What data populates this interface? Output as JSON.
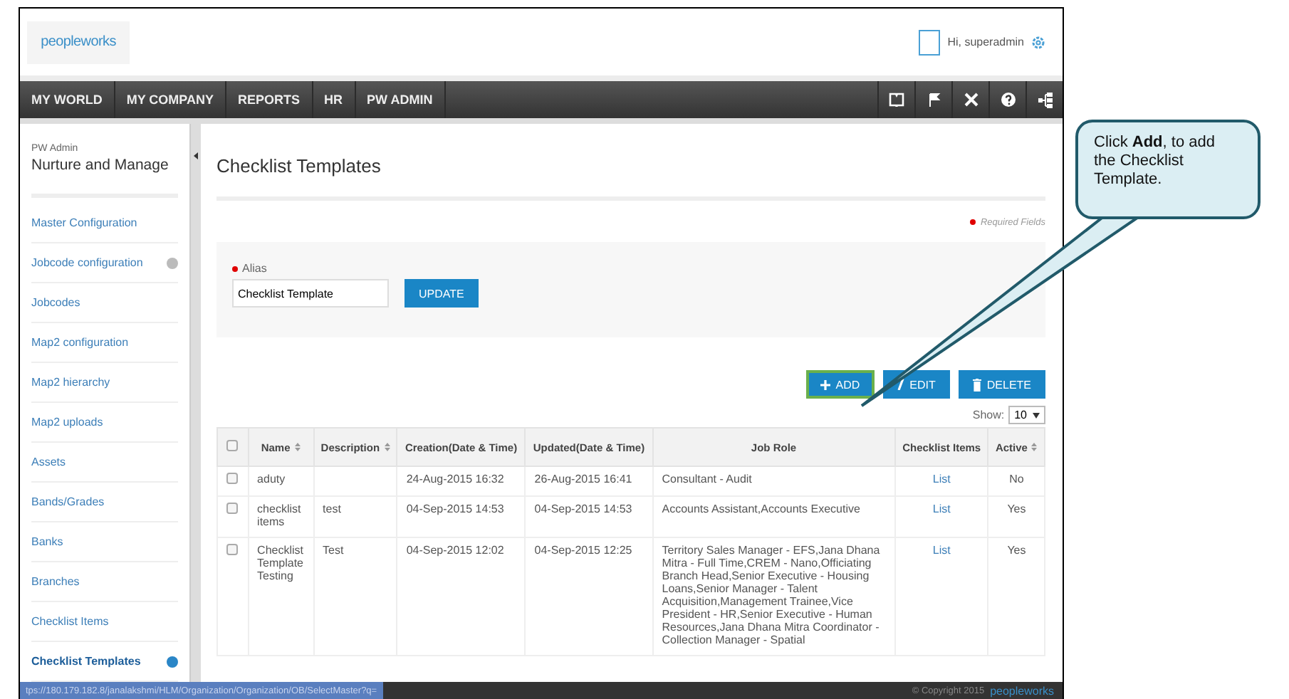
{
  "header": {
    "logo": "peopleworks",
    "greeting": "Hi, superadmin"
  },
  "nav": {
    "items": [
      {
        "label": "MY WORLD"
      },
      {
        "label": "MY COMPANY"
      },
      {
        "label": "REPORTS"
      },
      {
        "label": "HR"
      },
      {
        "label": "PW ADMIN"
      }
    ]
  },
  "sidebar": {
    "section": "PW Admin",
    "title": "Nurture and Manage",
    "items": [
      {
        "label": "Master Configuration",
        "selected": false,
        "toggle": false
      },
      {
        "label": "Jobcode configuration",
        "selected": false,
        "toggle": true
      },
      {
        "label": "Jobcodes",
        "selected": false,
        "toggle": false
      },
      {
        "label": "Map2 configuration",
        "selected": false,
        "toggle": false
      },
      {
        "label": "Map2 hierarchy",
        "selected": false,
        "toggle": false
      },
      {
        "label": "Map2 uploads",
        "selected": false,
        "toggle": false
      },
      {
        "label": "Assets",
        "selected": false,
        "toggle": false
      },
      {
        "label": "Bands/Grades",
        "selected": false,
        "toggle": false
      },
      {
        "label": "Banks",
        "selected": false,
        "toggle": false
      },
      {
        "label": "Branches",
        "selected": false,
        "toggle": false
      },
      {
        "label": "Checklist Items",
        "selected": false,
        "toggle": false
      },
      {
        "label": "Checklist Templates",
        "selected": true,
        "toggle": true
      }
    ]
  },
  "page": {
    "title": "Checklist Templates",
    "required_note": "Required Fields",
    "alias": {
      "label": "Alias",
      "value": "Checklist Template",
      "button": "UPDATE"
    },
    "actions": [
      {
        "kind": "add",
        "label": "ADD",
        "highlighted": true
      },
      {
        "kind": "edit",
        "label": "EDIT",
        "highlighted": false
      },
      {
        "kind": "delete",
        "label": "DELETE",
        "highlighted": false
      }
    ],
    "show": {
      "label": "Show:",
      "value": "10"
    }
  },
  "table": {
    "select_all_checked": false,
    "columns": [
      {
        "label": "Name",
        "sortable": true
      },
      {
        "label": "Description",
        "sortable": true
      },
      {
        "label": "Creation(Date & Time)",
        "sortable": false
      },
      {
        "label": "Updated(Date & Time)",
        "sortable": false
      },
      {
        "label": "Job Role",
        "sortable": false
      },
      {
        "label": "Checklist Items",
        "sortable": false
      },
      {
        "label": "Active",
        "sortable": true
      }
    ],
    "rows": [
      {
        "checked": false,
        "cells": [
          "aduty",
          "",
          "24-Aug-2015 16:32",
          "26-Aug-2015 16:41",
          "Consultant - Audit",
          "List",
          "No"
        ]
      },
      {
        "checked": false,
        "cells": [
          "checklist items",
          "test",
          "04-Sep-2015 14:53",
          "04-Sep-2015 14:53",
          "Accounts Assistant,Accounts Executive",
          "List",
          "Yes"
        ]
      },
      {
        "checked": false,
        "cells": [
          "Checklist Template Testing",
          "Test",
          "04-Sep-2015 12:02",
          "04-Sep-2015 12:25",
          "Territory Sales Manager - EFS,Jana Dhana Mitra - Full Time,CREM - Nano,Officiating Branch Head,Senior Executive - Housing Loans,Senior Manager - Talent Acquisition,Management Trainee,Vice President - HR,Senior Executive - Human Resources,Jana Dhana Mitra Coordinator - Collection Manager - Spatial",
          "List",
          "Yes"
        ]
      }
    ]
  },
  "status_bar": {
    "url": "tps://180.179.182.8/janalakshmi/HLM/Organization/Organization/OB/SelectMaster?q=",
    "copyright": "© Copyright 2015",
    "logo": "peopleworks"
  },
  "callout": {
    "text": "Click **Add**, to add the Checklist Template."
  }
}
